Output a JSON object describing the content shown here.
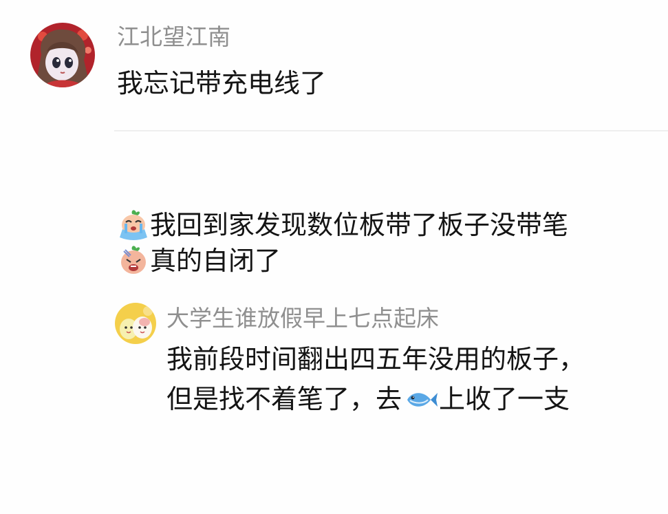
{
  "comment": {
    "author": "江北望江南",
    "text": "我忘记带充电线了"
  },
  "reply": {
    "line1": "我回到家发现数位板带了板子没带笔",
    "line2": "真的自闭了",
    "emoji1": "crying-sticker-icon",
    "emoji2": "sad-sticker-icon"
  },
  "nested_reply": {
    "author": "大学生谁放假早上七点起床",
    "line1": "我前段时间翻出四五年没用的板子，",
    "line2_before": "但是找不着笔了，去",
    "line2_after": "上收了一支",
    "inline_icon": "fish-icon"
  }
}
